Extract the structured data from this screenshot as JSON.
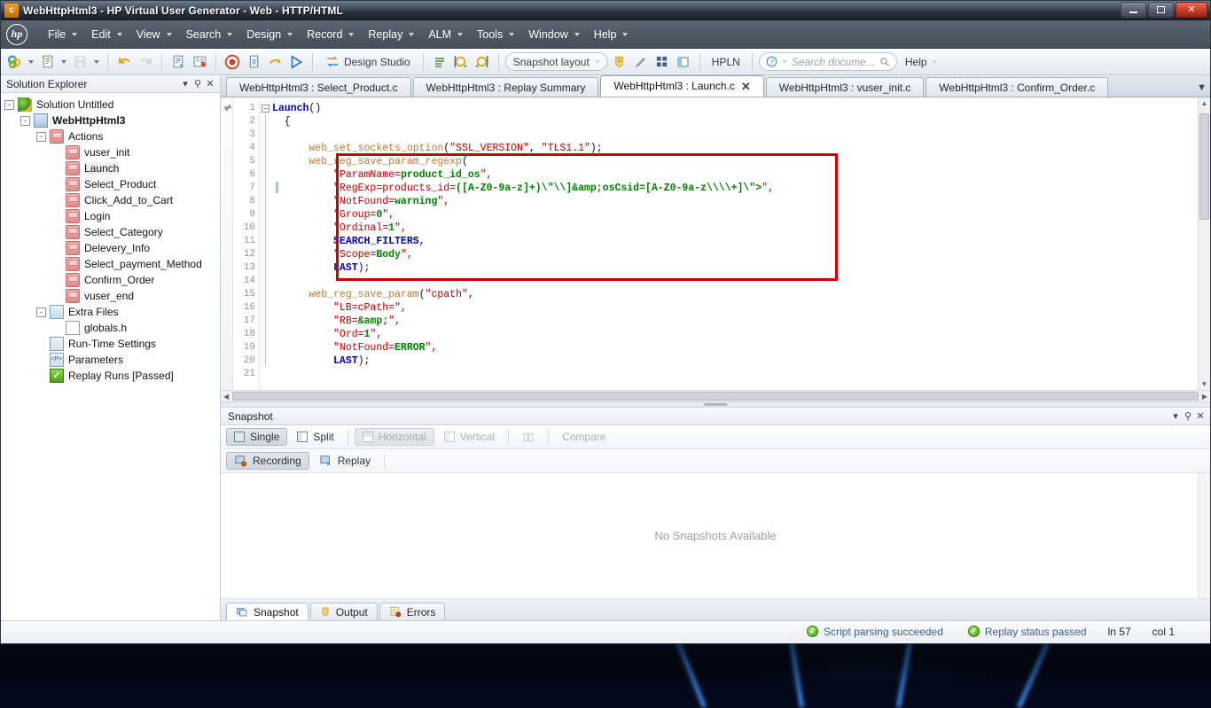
{
  "window": {
    "title": "WebHttpHtml3 - HP Virtual User Generator - Web - HTTP/HTML",
    "app_icon": "vugen-icon",
    "minimize_label": "Minimize",
    "restore_label": "Restore",
    "close_label": "Close"
  },
  "menubar": {
    "logo": "hp-logo",
    "items": [
      {
        "label": "File",
        "caret": true
      },
      {
        "label": "Edit",
        "caret": true
      },
      {
        "label": "View",
        "caret": true
      },
      {
        "label": "Search",
        "caret": true
      },
      {
        "label": "Design",
        "caret": true
      },
      {
        "label": "Record",
        "caret": true
      },
      {
        "label": "Replay",
        "caret": true
      },
      {
        "label": "ALM",
        "caret": true
      },
      {
        "label": "Tools",
        "caret": true
      },
      {
        "label": "Window",
        "caret": true
      },
      {
        "label": "Help",
        "caret": true
      }
    ]
  },
  "toolbar": {
    "open_solution_icon": "open-solution-icon",
    "new_script_icon": "new-script-icon",
    "save_icon": "save-icon",
    "undo_icon": "undo-icon",
    "redo_icon": "redo-icon",
    "compile_icon": "compile-icon",
    "runtime_settings_icon": "runtime-settings-icon",
    "record_icon": "record-icon",
    "stop_icon": "stop-icon",
    "replay_loop_icon": "replay-loop-icon",
    "run_icon": "run-icon",
    "design_studio_icon": "design-studio-icon",
    "design_studio_label": "Design Studio",
    "steps_icon": "steps-toolbox-icon",
    "prev_snapshot_icon": "previous-snapshot-icon",
    "next_snapshot_icon": "next-snapshot-icon",
    "snapshot_layout_label": "Snapshot layout",
    "bookmark_icon": "bookmark-icon",
    "highlight_icon": "highlight-icon",
    "grid_icon": "grid-icon",
    "panes_icon": "panes-icon",
    "hpln_label": "HPLN",
    "search_help_placeholder": "Search docume...",
    "search_icon": "search-icon",
    "help_question_icon": "help-question-icon",
    "help_label": "Help"
  },
  "solution_explorer": {
    "title": "Solution Explorer",
    "dropdown_icon": "chevron-down-icon",
    "pin_icon": "pin-icon",
    "close_icon": "close-icon",
    "tree": [
      {
        "label": "Solution Untitled",
        "indent": 0,
        "icon": "solution",
        "expander": "-"
      },
      {
        "label": "WebHttpHtml3",
        "indent": 1,
        "icon": "proj",
        "expander": "-",
        "bold": true
      },
      {
        "label": "Actions",
        "indent": 2,
        "icon": "action",
        "expander": "-"
      },
      {
        "label": "vuser_init",
        "indent": 3,
        "icon": "action",
        "expander": ""
      },
      {
        "label": "Launch",
        "indent": 3,
        "icon": "action",
        "expander": "",
        "highlight": true
      },
      {
        "label": "Select_Product",
        "indent": 3,
        "icon": "action",
        "expander": ""
      },
      {
        "label": "Click_Add_to_Cart",
        "indent": 3,
        "icon": "action",
        "expander": ""
      },
      {
        "label": "Login",
        "indent": 3,
        "icon": "action",
        "expander": ""
      },
      {
        "label": "Select_Category",
        "indent": 3,
        "icon": "action",
        "expander": ""
      },
      {
        "label": "Delevery_Info",
        "indent": 3,
        "icon": "action",
        "expander": ""
      },
      {
        "label": "Select_payment_Method",
        "indent": 3,
        "icon": "action",
        "expander": ""
      },
      {
        "label": "Confirm_Order",
        "indent": 3,
        "icon": "action",
        "expander": ""
      },
      {
        "label": "vuser_end",
        "indent": 3,
        "icon": "action",
        "expander": ""
      },
      {
        "label": "Extra Files",
        "indent": 2,
        "icon": "files",
        "expander": "-"
      },
      {
        "label": "globals.h",
        "indent": 3,
        "icon": "doc",
        "expander": ""
      },
      {
        "label": "Run-Time Settings",
        "indent": 2,
        "icon": "rts",
        "expander": ""
      },
      {
        "label": "Parameters",
        "indent": 2,
        "icon": "param",
        "expander": ""
      },
      {
        "label": "Replay Runs [Passed]",
        "indent": 2,
        "icon": "check",
        "expander": ""
      }
    ]
  },
  "editor": {
    "tabs": [
      {
        "label": "WebHttpHtml3 : Select_Product.c",
        "active": false,
        "closable": false
      },
      {
        "label": "WebHttpHtml3 : Replay Summary",
        "active": false,
        "closable": false
      },
      {
        "label": "WebHttpHtml3 : Launch.c",
        "active": true,
        "closable": true
      },
      {
        "label": "WebHttpHtml3 : vuser_init.c",
        "active": false,
        "closable": false
      },
      {
        "label": "WebHttpHtml3 : Confirm_Order.c",
        "active": false,
        "closable": false
      }
    ],
    "tab_overflow_icon": "tab-overflow-icon",
    "close_icon": "close-icon",
    "bookmark_gutter_icon": "bookmark-clip-icon",
    "line_numbers": [
      1,
      2,
      3,
      4,
      5,
      6,
      7,
      8,
      9,
      10,
      11,
      12,
      13,
      14,
      15,
      16,
      17,
      18,
      19,
      20,
      21
    ],
    "code_lines": [
      [
        {
          "t": "Launch",
          "c": "kw"
        },
        {
          "t": "()",
          "c": "plain"
        }
      ],
      [
        {
          "t": "  {",
          "c": "plain"
        }
      ],
      [
        {
          "t": "",
          "c": "plain"
        }
      ],
      [
        {
          "t": "      ",
          "c": "plain"
        },
        {
          "t": "web_set_sockets_option",
          "c": "fn"
        },
        {
          "t": "(",
          "c": "plain"
        },
        {
          "t": "\"SSL_VERSION\"",
          "c": "str"
        },
        {
          "t": ", ",
          "c": "plain"
        },
        {
          "t": "\"TLS1.1\"",
          "c": "str"
        },
        {
          "t": ");",
          "c": "plain"
        }
      ],
      [
        {
          "t": "      ",
          "c": "plain"
        },
        {
          "t": "web_reg_save_param_regexp",
          "c": "fn"
        },
        {
          "t": "(",
          "c": "plain"
        }
      ],
      [
        {
          "t": "          ",
          "c": "plain"
        },
        {
          "t": "\"ParamName=",
          "c": "str"
        },
        {
          "t": "product_id_os",
          "c": "grn"
        },
        {
          "t": "\",",
          "c": "str"
        }
      ],
      [
        {
          "t": "          ",
          "c": "plain"
        },
        {
          "t": "\"RegExp=products_id=",
          "c": "str"
        },
        {
          "t": "([A-Z0-9a-z]+)\\\"\\\\]&amp;osCsid=[A-Z0-9a-z\\\\\\\\+]\\\">",
          "c": "grn"
        },
        {
          "t": "\",",
          "c": "str"
        }
      ],
      [
        {
          "t": "          ",
          "c": "plain"
        },
        {
          "t": "\"NotFound=",
          "c": "str"
        },
        {
          "t": "warning",
          "c": "grn"
        },
        {
          "t": "\",",
          "c": "str"
        }
      ],
      [
        {
          "t": "          ",
          "c": "plain"
        },
        {
          "t": "\"Group=",
          "c": "str"
        },
        {
          "t": "0",
          "c": "grn"
        },
        {
          "t": "\",",
          "c": "str"
        }
      ],
      [
        {
          "t": "          ",
          "c": "plain"
        },
        {
          "t": "\"Ordinal=",
          "c": "str"
        },
        {
          "t": "1",
          "c": "grn"
        },
        {
          "t": "\",",
          "c": "str"
        }
      ],
      [
        {
          "t": "          ",
          "c": "plain"
        },
        {
          "t": "SEARCH_FILTERS",
          "c": "kw"
        },
        {
          "t": ",",
          "c": "plain"
        }
      ],
      [
        {
          "t": "          ",
          "c": "plain"
        },
        {
          "t": "\"Scope=",
          "c": "str"
        },
        {
          "t": "Body",
          "c": "grn"
        },
        {
          "t": "\",",
          "c": "str"
        }
      ],
      [
        {
          "t": "          ",
          "c": "plain"
        },
        {
          "t": "LAST",
          "c": "kw"
        },
        {
          "t": ");",
          "c": "plain"
        }
      ],
      [
        {
          "t": "",
          "c": "plain"
        }
      ],
      [
        {
          "t": "      ",
          "c": "plain"
        },
        {
          "t": "web_reg_save_param",
          "c": "fn"
        },
        {
          "t": "(",
          "c": "plain"
        },
        {
          "t": "\"cpath\"",
          "c": "str"
        },
        {
          "t": ",",
          "c": "plain"
        }
      ],
      [
        {
          "t": "          ",
          "c": "plain"
        },
        {
          "t": "\"LB=cPath=\",",
          "c": "str"
        }
      ],
      [
        {
          "t": "          ",
          "c": "plain"
        },
        {
          "t": "\"RB=",
          "c": "str"
        },
        {
          "t": "&amp;",
          "c": "grn"
        },
        {
          "t": "\",",
          "c": "str"
        }
      ],
      [
        {
          "t": "          ",
          "c": "plain"
        },
        {
          "t": "\"Ord=",
          "c": "str"
        },
        {
          "t": "1",
          "c": "grn"
        },
        {
          "t": "\",",
          "c": "str"
        }
      ],
      [
        {
          "t": "          ",
          "c": "plain"
        },
        {
          "t": "\"NotFound=",
          "c": "str"
        },
        {
          "t": "ERROR",
          "c": "grn"
        },
        {
          "t": "\",",
          "c": "str"
        }
      ],
      [
        {
          "t": "          ",
          "c": "plain"
        },
        {
          "t": "LAST",
          "c": "kw"
        },
        {
          "t": ");",
          "c": "plain"
        }
      ],
      [
        {
          "t": "",
          "c": "plain"
        }
      ]
    ],
    "annotation_color": "#d00000"
  },
  "snapshot": {
    "title": "Snapshot",
    "dropdown_icon": "chevron-down-icon",
    "pin_icon": "pin-icon",
    "close_icon": "close-icon",
    "view_buttons": [
      {
        "label": "Single",
        "state": "on",
        "icon": "single-pane-icon"
      },
      {
        "label": "Split",
        "state": "normal",
        "icon": "split-pane-icon"
      },
      {
        "label": "Horizontal",
        "state": "dim-on",
        "icon": "horizontal-layout-icon"
      },
      {
        "label": "Vertical",
        "state": "dim",
        "icon": "vertical-layout-icon"
      },
      {
        "label": "Compare",
        "state": "dim",
        "icon": "compare-icon"
      }
    ],
    "source_buttons": [
      {
        "label": "Recording",
        "state": "on",
        "icon": "recording-icon"
      },
      {
        "label": "Replay",
        "state": "normal",
        "icon": "replay-icon"
      }
    ],
    "empty_message": "No Snapshots Available",
    "bottom_tabs": [
      {
        "label": "Snapshot",
        "active": true,
        "icon": "snapshot-icon"
      },
      {
        "label": "Output",
        "active": false,
        "icon": "output-icon"
      },
      {
        "label": "Errors",
        "active": false,
        "icon": "errors-icon"
      }
    ]
  },
  "statusbar": {
    "parsing_icon": "check-circle-icon",
    "parsing_text": "Script parsing succeeded",
    "replay_icon": "check-circle-icon",
    "replay_text": "Replay status passed",
    "line_text": "ln 57",
    "col_text": "col 1"
  }
}
